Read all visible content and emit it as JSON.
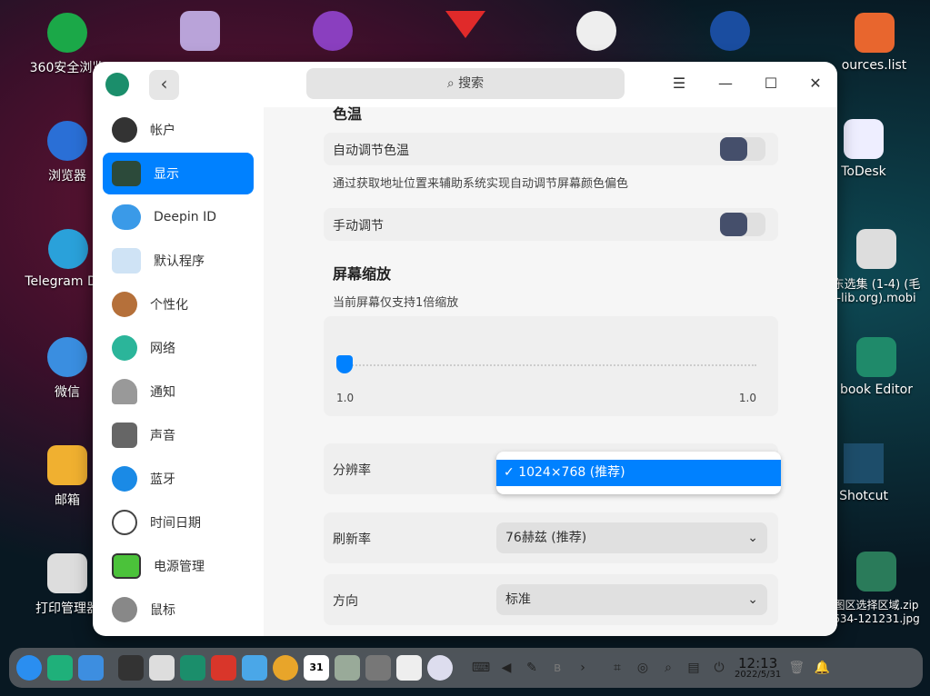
{
  "desktop": {
    "left": [
      "360安全浏览",
      "浏览器",
      "Telegram Des",
      "微信",
      "邮箱",
      "打印管理器"
    ],
    "right": [
      "ources.list",
      "ToDesk",
      "东选集 (1-4) (毛\n-lib.org).mobi",
      "book Editor",
      "Shotcut",
      "图区选择区域.zip\n634-121231.jpg"
    ]
  },
  "window": {
    "search_placeholder": "搜索",
    "back": "‹",
    "sidebar": [
      "帐户",
      "显示",
      "Deepin ID",
      "默认程序",
      "个性化",
      "网络",
      "通知",
      "声音",
      "蓝牙",
      "时间日期",
      "电源管理",
      "鼠标"
    ],
    "active_index": 1
  },
  "display": {
    "color_temp_heading": "色温",
    "auto_temp": "自动调节色温",
    "auto_temp_on": false,
    "auto_temp_desc": "通过获取地址位置来辅助系统实现自动调节屏幕颜色偏色",
    "manual": "手动调节",
    "manual_on": false,
    "scale_heading": "屏幕缩放",
    "scale_desc": "当前屏幕仅支持1倍缩放",
    "scale_min": "1.0",
    "scale_max": "1.0",
    "scale_value": 1.0,
    "resolution_label": "分辨率",
    "resolution_option": "1024×768 (推荐)",
    "refresh_label": "刷新率",
    "refresh_value": "76赫兹 (推荐)",
    "orientation_label": "方向",
    "orientation_value": "标准"
  },
  "dock": {
    "time": "12:13",
    "date": "2022/5/31",
    "calendar_day": "31"
  },
  "colors": {
    "accent": "#0081ff"
  }
}
